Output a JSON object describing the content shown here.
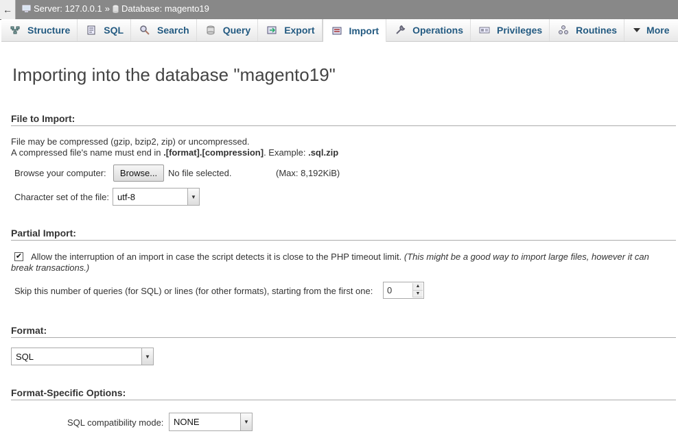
{
  "breadcrumb": {
    "server_label": "Server: 127.0.0.1",
    "separator": "»",
    "database_label": "Database: magento19"
  },
  "tabs": [
    {
      "label": "Structure",
      "icon": "structure-icon"
    },
    {
      "label": "SQL",
      "icon": "sql-icon"
    },
    {
      "label": "Search",
      "icon": "search-icon"
    },
    {
      "label": "Query",
      "icon": "query-icon"
    },
    {
      "label": "Export",
      "icon": "export-icon"
    },
    {
      "label": "Import",
      "icon": "import-icon",
      "active": true
    },
    {
      "label": "Operations",
      "icon": "wrench-icon"
    },
    {
      "label": "Privileges",
      "icon": "privileges-icon"
    },
    {
      "label": "Routines",
      "icon": "routines-icon"
    },
    {
      "label": "More",
      "icon": "triangle-down-icon"
    }
  ],
  "page_title": "Importing into the database \"magento19\"",
  "file_import": {
    "heading": "File to Import:",
    "line1": "File may be compressed (gzip, bzip2, zip) or uncompressed.",
    "line2_prefix": "A compressed file's name must end in ",
    "line2_bold": ".[format].[compression]",
    "line2_mid": ". Example: ",
    "line2_example": ".sql.zip",
    "browse_label": "Browse your computer:",
    "browse_button": "Browse...",
    "no_file": "No file selected.",
    "max_size": "(Max: 8,192KiB)",
    "charset_label": "Character set of the file:",
    "charset_value": "utf-8"
  },
  "partial_import": {
    "heading": "Partial Import:",
    "allow_label": "Allow the interruption of an import in case the script detects it is close to the PHP timeout limit.",
    "allow_note_line1": "(This might be a good way to import large files, however it can",
    "allow_note_line2": "break transactions.)",
    "allow_checked": true,
    "skip_label": "Skip this number of queries (for SQL) or lines (for other formats), starting from the first one:",
    "skip_value": "0"
  },
  "format": {
    "heading": "Format:",
    "value": "SQL"
  },
  "format_options": {
    "heading": "Format-Specific Options:",
    "compat_label": "SQL compatibility mode:",
    "compat_value": "NONE"
  }
}
